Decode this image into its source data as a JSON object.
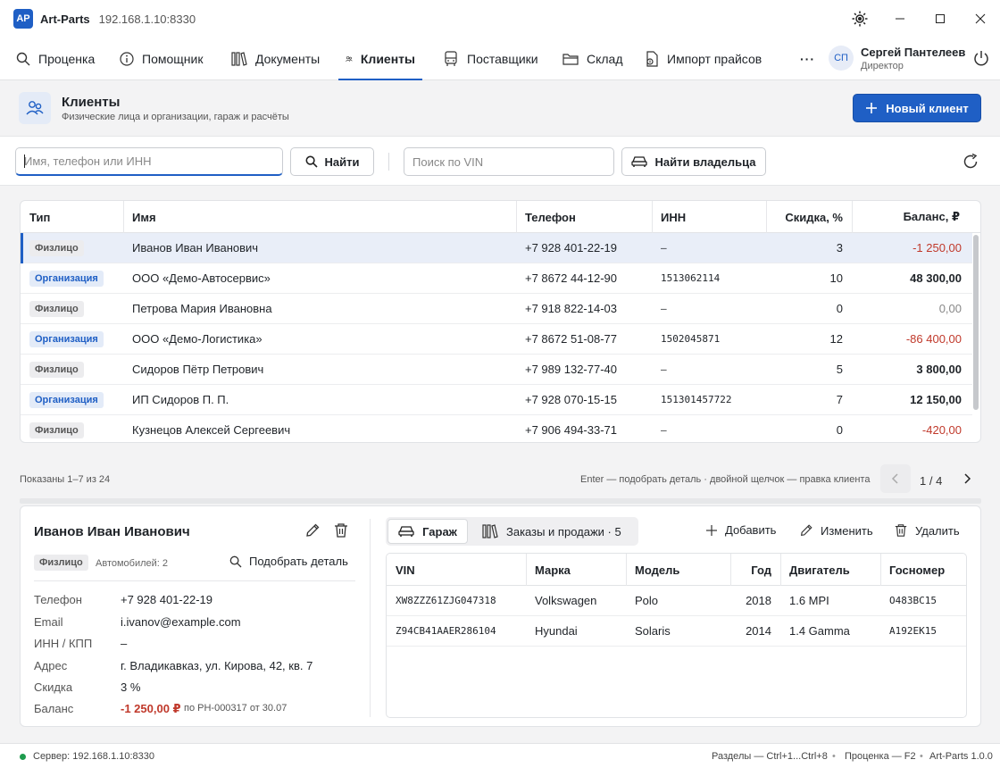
{
  "titlebar": {
    "logo": "AP",
    "app_name": "Art-Parts",
    "server": "192.168.1.10:8330"
  },
  "nav": {
    "tabs": [
      {
        "label": "Проценка",
        "icon": "search-icon"
      },
      {
        "label": "Помощник",
        "icon": "info-icon"
      },
      {
        "label": "Документы",
        "icon": "books-icon"
      },
      {
        "label": "Клиенты",
        "icon": "users-icon"
      },
      {
        "label": "Поставщики",
        "icon": "bus-icon"
      },
      {
        "label": "Склад",
        "icon": "folder-icon"
      },
      {
        "label": "Импорт прайсов",
        "icon": "file-import-icon"
      }
    ],
    "more": "···",
    "active": "Клиенты",
    "user": {
      "initials": "СП",
      "name": "Сергей Пантелеев",
      "role": "Директор"
    }
  },
  "header": {
    "title": "Клиенты",
    "subtitle": "Физические лица и организации, гараж и расчёты",
    "new_button": "Новый клиент"
  },
  "search": {
    "placeholder": "Имя, телефон или ИНН",
    "find_label": "Найти",
    "vin_placeholder": "Поиск по VIN",
    "find_owner_label": "Найти владельца"
  },
  "table": {
    "columns": [
      "Тип",
      "Имя",
      "Телефон",
      "ИНН",
      "Скидка, %",
      "Баланс, ₽"
    ],
    "rows": [
      {
        "type": "Физлицо",
        "name": "Иванов Иван Иванович",
        "phone": "+7 928 401-22-19",
        "inn": "–",
        "discount": "3",
        "balance": "-1 250,00"
      },
      {
        "type": "Организация",
        "name": "ООО «Демо-Автосервис»",
        "phone": "+7 8672 44-12-90",
        "inn": "1513062114",
        "discount": "10",
        "balance": "48 300,00"
      },
      {
        "type": "Физлицо",
        "name": "Петрова Мария Ивановна",
        "phone": "+7 918 822-14-03",
        "inn": "–",
        "discount": "0",
        "balance": "0,00"
      },
      {
        "type": "Организация",
        "name": "ООО «Демо-Логистика»",
        "phone": "+7 8672 51-08-77",
        "inn": "1502045871",
        "discount": "12",
        "balance": "-86 400,00"
      },
      {
        "type": "Физлицо",
        "name": "Сидоров Пётр Петрович",
        "phone": "+7 989 132-77-40",
        "inn": "–",
        "discount": "5",
        "balance": "3 800,00"
      },
      {
        "type": "Организация",
        "name": "ИП Сидоров П. П.",
        "phone": "+7 928 070-15-15",
        "inn": "151301457722",
        "discount": "7",
        "balance": "12 150,00"
      },
      {
        "type": "Физлицо",
        "name": "Кузнецов Алексей Сергеевич",
        "phone": "+7 906 494-33-71",
        "inn": "–",
        "discount": "0",
        "balance": "-420,00"
      }
    ],
    "selected_index": 0
  },
  "pager": {
    "shown": "Показаны 1–7 из 24",
    "hint": "Enter — подобрать деталь · двойной щелчок — правка клиента",
    "page": "1 / 4"
  },
  "detail": {
    "name": "Иванов Иван Иванович",
    "type": "Физлицо",
    "cars": "Автомобилей: 2",
    "pick_part": "Подобрать деталь",
    "fields": [
      {
        "label": "Телефон",
        "value": "+7 928 401-22-19"
      },
      {
        "label": "Email",
        "value": "i.ivanov@example.com"
      },
      {
        "label": "ИНН / КПП",
        "value": "–"
      },
      {
        "label": "Адрес",
        "value": "г. Владикавказ, ул. Кирова, 42, кв. 7"
      },
      {
        "label": "Скидка",
        "value": "3 %"
      }
    ],
    "balance_label": "Баланс",
    "balance_value": "-1 250,00 ₽",
    "balance_note": "по РН-000317 от 30.07",
    "tabs": {
      "garage": "Гараж",
      "orders": "Заказы и продажи · 5"
    },
    "actions": {
      "add": "Добавить",
      "edit": "Изменить",
      "delete": "Удалить"
    },
    "cars_columns": [
      "VIN",
      "Марка",
      "Модель",
      "Год",
      "Двигатель",
      "Госномер"
    ],
    "cars_rows": [
      {
        "vin": "XW8ZZZ61ZJG047318",
        "brand": "Volkswagen",
        "model": "Polo",
        "year": "2018",
        "engine": "1.6 MPI",
        "plate": "О483ВС15"
      },
      {
        "vin": "Z94CB41AAER286104",
        "brand": "Hyundai",
        "model": "Solaris",
        "year": "2014",
        "engine": "1.4 Gamma",
        "plate": "А192ЕК15"
      }
    ]
  },
  "status": {
    "server": "Сервер: 192.168.1.10:8330",
    "hotkeys": "Разделы — Ctrl+1...Ctrl+8",
    "sep": "•",
    "f2": "Проценка — F2",
    "version": "Art-Parts 1.0.0"
  },
  "colors": {
    "accent": "#1f5fc5",
    "negative": "#c0392b",
    "online": "#1e9b4d"
  }
}
